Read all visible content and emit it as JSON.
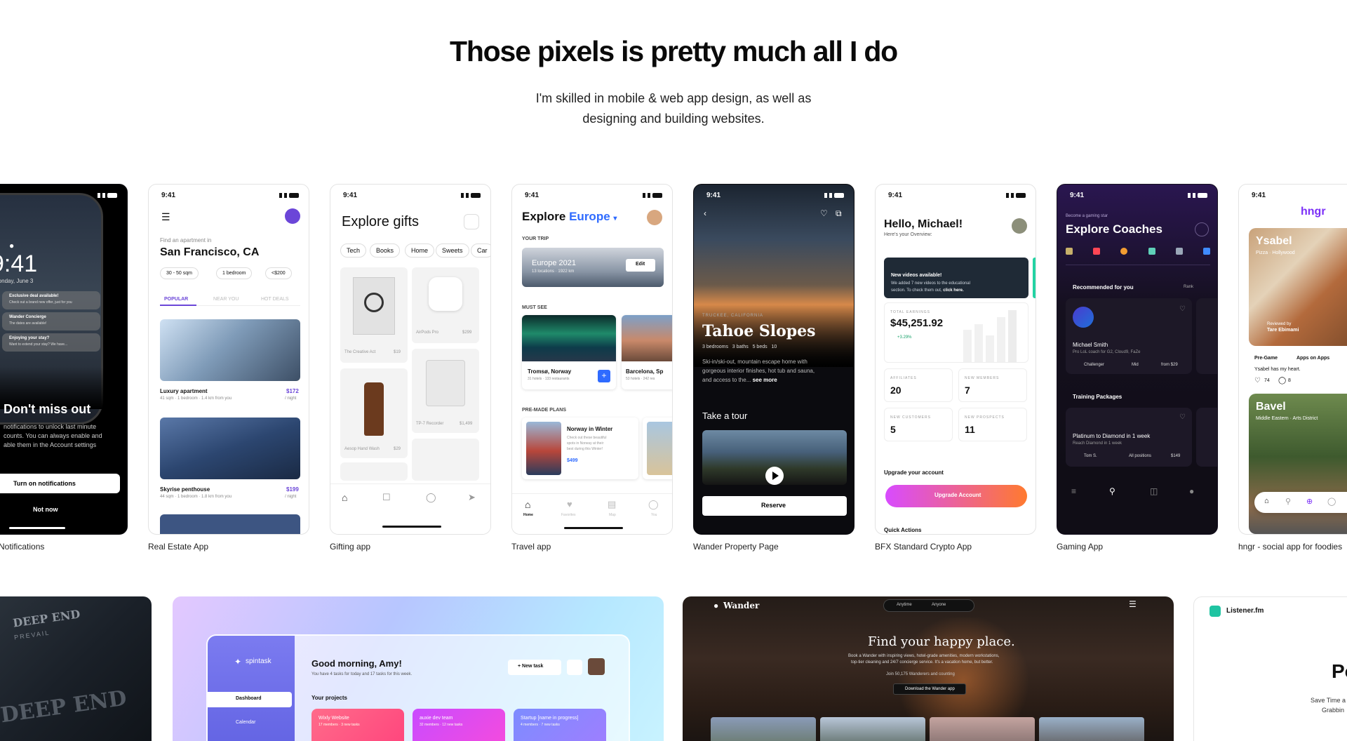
{
  "hero": {
    "title": "Those pixels is pretty much all I do",
    "subtitle_line1": "I'm skilled in mobile & web app design, as well as",
    "subtitle_line2": "designing and building websites."
  },
  "status_time": "9:41",
  "cards": {
    "notifications": {
      "caption": "Notifications",
      "lock_time": "9:41",
      "lock_date": "Monday, June 3",
      "n1": "Exclusive deal available!",
      "n1_sub": "Check out a brand new offer, just for you",
      "n2": "Wander Concierge",
      "n2_sub": "The dates are available!",
      "n3": "Enjoying your stay?",
      "n3_sub": "Want to extend your stay? We have...",
      "headline": "Don't miss out",
      "body1": "notifications to unlock last minute",
      "body2": "counts. You can always enable and",
      "body3": "able them in the Account settings",
      "primary": "Turn on notifications",
      "secondary": "Not now"
    },
    "real_estate": {
      "caption": "Real Estate App",
      "eyebrow": "Find an apartment in",
      "city": "San Francisco, CA",
      "chip1": "30 - 50 sqm",
      "chip2": "1 bedroom",
      "chip3": "<$200",
      "tab1": "POPULAR",
      "tab2": "NEAR YOU",
      "tab3": "HOT DEALS",
      "l1_title": "Luxury apartment",
      "l1_price": "$172",
      "l1_meta": "41 sqm · 1 bedroom · 1.4 km from you",
      "l1_unit": "/ night",
      "l2_title": "Skyrise penthouse",
      "l2_price": "$199",
      "l2_meta": "44 sqm · 1 bedroom · 1.8 km from you",
      "l2_unit": "/ night"
    },
    "gifting": {
      "caption": "Gifting app",
      "title": "Explore gifts",
      "chips": [
        "Tech",
        "Books",
        "Home",
        "Sweets",
        "Car"
      ],
      "p1": "The Creative Act",
      "p1_price": "$19",
      "p2": "AirPods Pro",
      "p2_price": "$299",
      "p3": "Aesop Hand Wash",
      "p3_price": "$29",
      "p4": "TP-7 Recorder",
      "p4_price": "$1,499"
    },
    "travel": {
      "caption": "Travel app",
      "title_a": "Explore",
      "title_b": "Europe",
      "your_trip": "YOUR TRIP",
      "trip_name": "Europe 2021",
      "trip_meta": "13 locations · 1922 km",
      "edit": "Edit",
      "must_see": "MUST SEE",
      "place1": "Tromsø, Norway",
      "place1_meta": "31 hotels · 133 restaurants",
      "place2": "Barcelona, Sp",
      "place2_meta": "53 hotels · 242 res",
      "premade": "PRE-MADE PLANS",
      "plan_title": "Norway in Winter",
      "plan_desc1": "Check out these beautiful",
      "plan_desc2": "spots in Norway at their",
      "plan_desc3": "best during this Winter!",
      "plan_price": "$499",
      "nav": [
        "Home",
        "Favorites",
        "Map",
        "You"
      ]
    },
    "wander": {
      "caption": "Wander Property Page",
      "location": "TRUCKEE, CALIFORNIA",
      "title": "Tahoe Slopes",
      "specs": "3 bedrooms   3 baths   5 beds   10",
      "desc1": "Ski-in/ski-out, mountain escape home with",
      "desc2": "gorgeous interior finishes, hot tub and sauna,",
      "desc3": "and access to the...",
      "see_more": "see more",
      "tour": "Take a tour",
      "reserve": "Reserve"
    },
    "crypto": {
      "caption": "BFX Standard Crypto App",
      "greeting": "Hello, Michael!",
      "overview": "Here's your Overview:",
      "banner_title": "New videos available!",
      "banner_body1": "We added 7 new videos to the educational",
      "banner_body2": "section. To check them out,",
      "banner_link": "click here.",
      "earnings_label": "TOTAL EARNINGS",
      "earnings": "$45,251.92",
      "change": "+3.29%",
      "affiliates_label": "AFFILIATES",
      "affiliates": "20",
      "members_label": "NEW MEMBERS",
      "members": "7",
      "customers_label": "NEW CUSTOMERS",
      "customers": "5",
      "prospects_label": "NEW PROSPECTS",
      "prospects": "11",
      "upgrade_title": "Upgrade your account",
      "upgrade_btn": "Upgrade Account",
      "quick": "Quick Actions"
    },
    "gaming": {
      "caption": "Gaming App",
      "eyebrow": "Become a gaming star",
      "title": "Explore Coaches",
      "recommended": "Recommended for you",
      "rank": "Rank",
      "coach": "Michael Smith",
      "coach_sub": "Pro LoL coach for G2, Cloud9, FaZe",
      "tag1": "Challenger",
      "tag2": "Mid",
      "tag3": "from $29",
      "packages": "Training Packages",
      "pkg_title": "Platinum to Diamond in 1 week",
      "pkg_sub": "Reach Diamond in 1 week",
      "pkg_coach": "Tom S.",
      "pkg_pos": "All positions",
      "pkg_price": "$149"
    },
    "hngr": {
      "caption": "hngr - social app for foodies",
      "logo": "hngr",
      "place1": "Ysabel",
      "place1_sub": "Pizza · Hollywood",
      "reviewed": "Reviewed by",
      "reviewer": "Tare Ebimami",
      "tag1": "Pre-Game",
      "tag2": "Apps on Apps",
      "quote": "Ysabel has my heart.",
      "likes": "74",
      "comments": "8",
      "place2": "Bavel",
      "place2_sub": "Middle Eastern · Arts District"
    }
  },
  "wide": {
    "spintask": {
      "brand": "spintask",
      "greeting": "Good morning, Amy!",
      "sub": "You have 4 tasks for today and 17 tasks for this week.",
      "new_task": "+ New task",
      "nav1": "Dashboard",
      "nav2": "Calendar",
      "projects": "Your projects",
      "proj1": "Wixly Website",
      "proj1_meta": "17 members · 3 new tasks",
      "proj2": "auxie dev team",
      "proj2_meta": "32 members · 12 new tasks",
      "proj3": "Startup [name in progress]",
      "proj3_meta": "4 members · 7 new tasks"
    },
    "wander_site": {
      "brand": "Wander",
      "pill1": "Anytime",
      "pill2": "Anyone",
      "headline": "Find your happy place.",
      "body1": "Book a Wander with inspiring views, hotel-grade amenities, modern workstations,",
      "body2": "top-tier cleaning and 24/7 concierge service. It's a vacation home, but better.",
      "reviews": "Join 50,175 Wanderers and counting",
      "download": "Download the Wander app"
    },
    "deep_end": {
      "text1": "DEEP END",
      "text2": "PREVAIL"
    },
    "listener": {
      "brand": "Listener.fm",
      "big": "Po",
      "line1": "Save Time a",
      "line2": "Grabbin"
    }
  },
  "colors": {
    "accent_blue": "#2f6bff",
    "gaming_purple": "#2a1650",
    "crypto_gradient_a": "#d84bff",
    "crypto_gradient_b": "#ff7a2f",
    "hngr_purple": "#7b2ff7"
  }
}
